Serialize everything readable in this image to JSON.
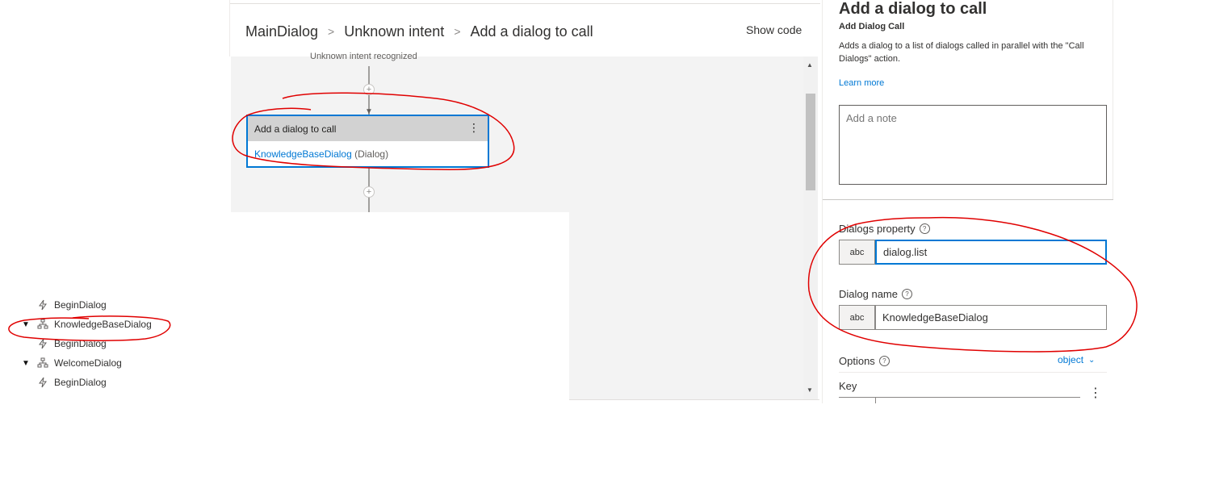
{
  "tree": {
    "items": [
      {
        "label": "BeginDialog",
        "kind": "trigger",
        "icon": "lightning-icon"
      },
      {
        "label": "KnowledgeBaseDialog",
        "kind": "dialog",
        "icon": "hierarchy-icon",
        "expanded": true
      },
      {
        "label": "BeginDialog",
        "kind": "trigger",
        "icon": "lightning-icon"
      },
      {
        "label": "WelcomeDialog",
        "kind": "dialog",
        "icon": "hierarchy-icon",
        "expanded": true
      },
      {
        "label": "BeginDialog",
        "kind": "trigger",
        "icon": "lightning-icon"
      }
    ]
  },
  "designer": {
    "breadcrumb": [
      "MainDialog",
      "Unknown intent",
      "Add a dialog to call"
    ],
    "show_code_label": "Show code",
    "trigger_label": "Unknown intent recognized",
    "card": {
      "title": "Add a dialog to call",
      "dialog_link": "KnowledgeBaseDialog",
      "dialog_suffix": " (Dialog)",
      "menu_icon": "more-vertical-icon"
    }
  },
  "panel": {
    "title": "Add a dialog to call",
    "subtitle": "Add Dialog Call",
    "description": "Adds a dialog to a list of dialogs called in parallel with the \"Call Dialogs\" action.",
    "learn_more": "Learn more",
    "note_placeholder": "Add a note",
    "dialogs_property": {
      "label": "Dialogs property",
      "type": "abc",
      "value": "dialog.list"
    },
    "dialog_name": {
      "label": "Dialog name",
      "type": "abc",
      "value": "KnowledgeBaseDialog"
    },
    "options": {
      "label": "Options",
      "type": "object"
    },
    "key_label": "Key"
  },
  "colors": {
    "accent": "#0078d4",
    "annotation": "#e00000",
    "card_header": "#d2d2d2",
    "canvas": "#f3f3f3"
  }
}
